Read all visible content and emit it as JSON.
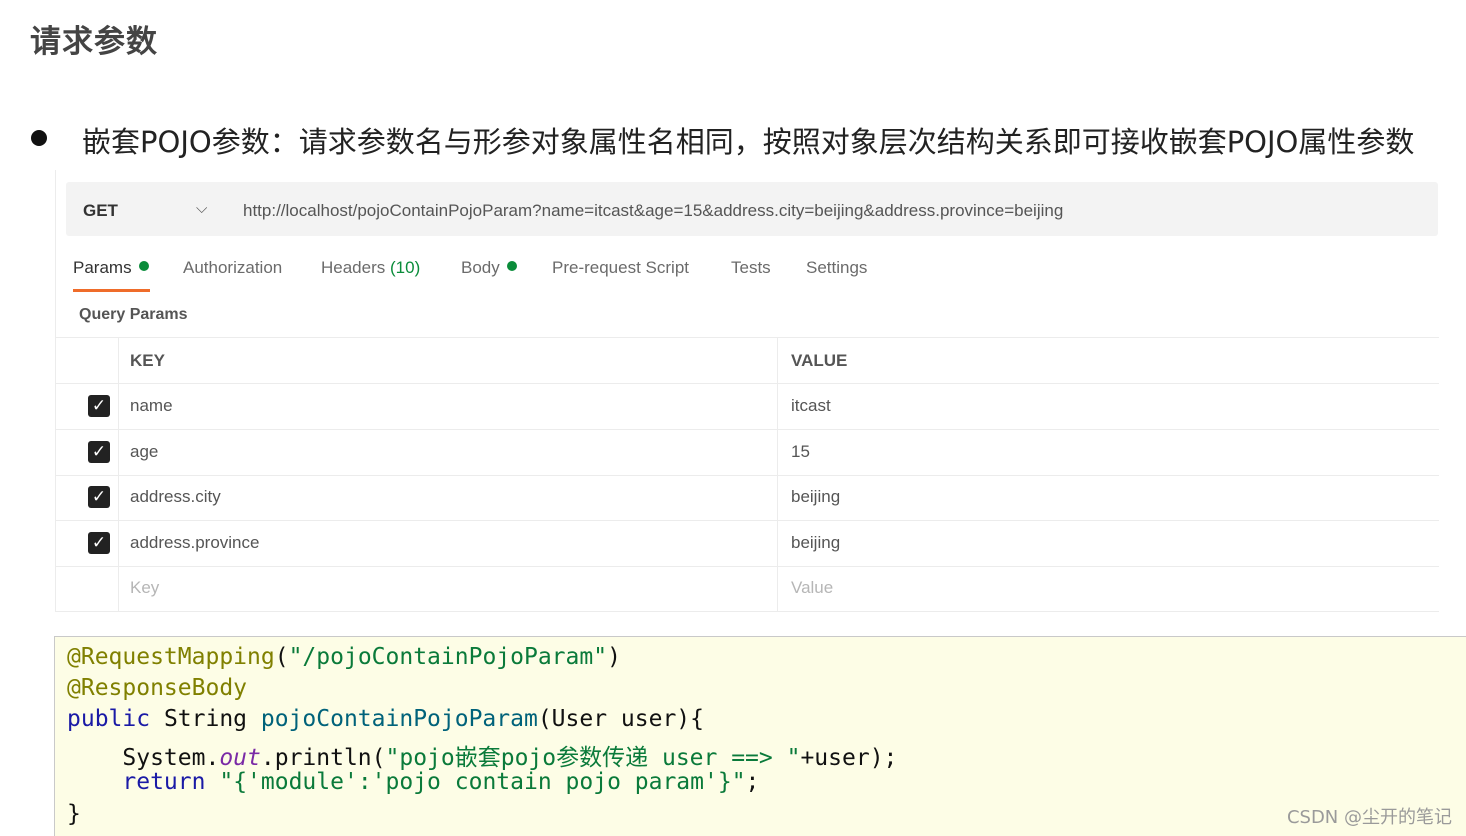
{
  "page_title": "请求参数",
  "bullet_text": "嵌套POJO参数：请求参数名与形参对象属性名相同，按照对象层次结构关系即可接收嵌套POJO属性参数",
  "request": {
    "method": "GET",
    "url": "http://localhost/pojoContainPojoParam?name=itcast&age=15&address.city=beijing&address.province=beijing"
  },
  "tabs": [
    {
      "label": "Params",
      "dot": true,
      "active": true
    },
    {
      "label": "Authorization"
    },
    {
      "label": "Headers",
      "count": "(10)"
    },
    {
      "label": "Body",
      "dot": true
    },
    {
      "label": "Pre-request Script"
    },
    {
      "label": "Tests"
    },
    {
      "label": "Settings"
    }
  ],
  "query_params": {
    "label": "Query Params",
    "headers": {
      "key": "KEY",
      "value": "VALUE"
    },
    "rows": [
      {
        "key": "name",
        "value": "itcast",
        "checked": true
      },
      {
        "key": "age",
        "value": "15",
        "checked": true
      },
      {
        "key": "address.city",
        "value": "beijing",
        "checked": true
      },
      {
        "key": "address.province",
        "value": "beijing",
        "checked": true
      }
    ],
    "placeholder": {
      "key": "Key",
      "value": "Value"
    }
  },
  "code": {
    "l1_ann": "@RequestMapping",
    "l1_open": "(",
    "l1_str": "\"/pojoContainPojoParam\"",
    "l1_close": ")",
    "l2_ann": "@ResponseBody",
    "l3_kw": "public",
    "l3_type": " String ",
    "l3_fn": "pojoContainPojoParam",
    "l3_rest": "(User user){",
    "l4_a": "    System.",
    "l4_fld": "out",
    "l4_b": ".println(",
    "l4_str": "\"pojo嵌套pojo参数传递 user ==> \"",
    "l4_c": "+user);",
    "l5_kw": "    return",
    "l5_sp": " ",
    "l5_str": "\"{'module':'pojo contain pojo param'}\"",
    "l5_end": ";",
    "l6": "}"
  },
  "watermark": "CSDN @尘开的笔记",
  "colors": {
    "accent": "#ef6c2a",
    "dot": "#0a8c3a",
    "code_bg": "#fdfde6"
  }
}
